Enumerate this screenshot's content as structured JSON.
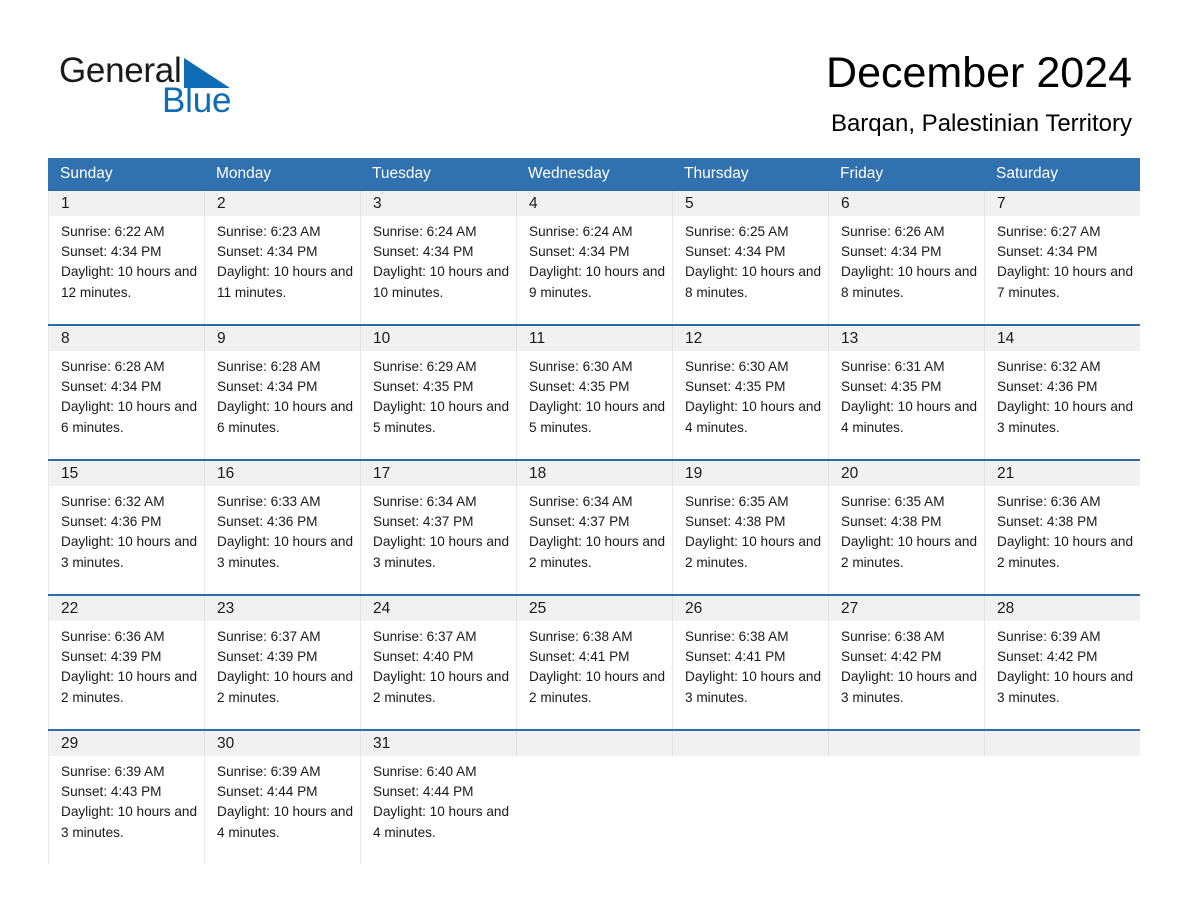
{
  "brand": {
    "name_part1": "General",
    "name_part2": "Blue",
    "triangle_color": "#0d6cb5",
    "text_color": "#1a1a1a"
  },
  "header": {
    "month_title": "December 2024",
    "location": "Barqan, Palestinian Territory"
  },
  "theme": {
    "header_blue": "#3071b0",
    "separator_blue": "#2e6da4",
    "date_band_gray": "#f1f1f1",
    "cell_border": "#e8e8e8"
  },
  "weekdays": [
    "Sunday",
    "Monday",
    "Tuesday",
    "Wednesday",
    "Thursday",
    "Friday",
    "Saturday"
  ],
  "weeks": [
    {
      "days": [
        {
          "date": "1",
          "sunrise": "Sunrise: 6:22 AM",
          "sunset": "Sunset: 4:34 PM",
          "daylight": "Daylight: 10 hours and 12 minutes."
        },
        {
          "date": "2",
          "sunrise": "Sunrise: 6:23 AM",
          "sunset": "Sunset: 4:34 PM",
          "daylight": "Daylight: 10 hours and 11 minutes."
        },
        {
          "date": "3",
          "sunrise": "Sunrise: 6:24 AM",
          "sunset": "Sunset: 4:34 PM",
          "daylight": "Daylight: 10 hours and 10 minutes."
        },
        {
          "date": "4",
          "sunrise": "Sunrise: 6:24 AM",
          "sunset": "Sunset: 4:34 PM",
          "daylight": "Daylight: 10 hours and 9 minutes."
        },
        {
          "date": "5",
          "sunrise": "Sunrise: 6:25 AM",
          "sunset": "Sunset: 4:34 PM",
          "daylight": "Daylight: 10 hours and 8 minutes."
        },
        {
          "date": "6",
          "sunrise": "Sunrise: 6:26 AM",
          "sunset": "Sunset: 4:34 PM",
          "daylight": "Daylight: 10 hours and 8 minutes."
        },
        {
          "date": "7",
          "sunrise": "Sunrise: 6:27 AM",
          "sunset": "Sunset: 4:34 PM",
          "daylight": "Daylight: 10 hours and 7 minutes."
        }
      ]
    },
    {
      "days": [
        {
          "date": "8",
          "sunrise": "Sunrise: 6:28 AM",
          "sunset": "Sunset: 4:34 PM",
          "daylight": "Daylight: 10 hours and 6 minutes."
        },
        {
          "date": "9",
          "sunrise": "Sunrise: 6:28 AM",
          "sunset": "Sunset: 4:34 PM",
          "daylight": "Daylight: 10 hours and 6 minutes."
        },
        {
          "date": "10",
          "sunrise": "Sunrise: 6:29 AM",
          "sunset": "Sunset: 4:35 PM",
          "daylight": "Daylight: 10 hours and 5 minutes."
        },
        {
          "date": "11",
          "sunrise": "Sunrise: 6:30 AM",
          "sunset": "Sunset: 4:35 PM",
          "daylight": "Daylight: 10 hours and 5 minutes."
        },
        {
          "date": "12",
          "sunrise": "Sunrise: 6:30 AM",
          "sunset": "Sunset: 4:35 PM",
          "daylight": "Daylight: 10 hours and 4 minutes."
        },
        {
          "date": "13",
          "sunrise": "Sunrise: 6:31 AM",
          "sunset": "Sunset: 4:35 PM",
          "daylight": "Daylight: 10 hours and 4 minutes."
        },
        {
          "date": "14",
          "sunrise": "Sunrise: 6:32 AM",
          "sunset": "Sunset: 4:36 PM",
          "daylight": "Daylight: 10 hours and 3 minutes."
        }
      ]
    },
    {
      "days": [
        {
          "date": "15",
          "sunrise": "Sunrise: 6:32 AM",
          "sunset": "Sunset: 4:36 PM",
          "daylight": "Daylight: 10 hours and 3 minutes."
        },
        {
          "date": "16",
          "sunrise": "Sunrise: 6:33 AM",
          "sunset": "Sunset: 4:36 PM",
          "daylight": "Daylight: 10 hours and 3 minutes."
        },
        {
          "date": "17",
          "sunrise": "Sunrise: 6:34 AM",
          "sunset": "Sunset: 4:37 PM",
          "daylight": "Daylight: 10 hours and 3 minutes."
        },
        {
          "date": "18",
          "sunrise": "Sunrise: 6:34 AM",
          "sunset": "Sunset: 4:37 PM",
          "daylight": "Daylight: 10 hours and 2 minutes."
        },
        {
          "date": "19",
          "sunrise": "Sunrise: 6:35 AM",
          "sunset": "Sunset: 4:38 PM",
          "daylight": "Daylight: 10 hours and 2 minutes."
        },
        {
          "date": "20",
          "sunrise": "Sunrise: 6:35 AM",
          "sunset": "Sunset: 4:38 PM",
          "daylight": "Daylight: 10 hours and 2 minutes."
        },
        {
          "date": "21",
          "sunrise": "Sunrise: 6:36 AM",
          "sunset": "Sunset: 4:38 PM",
          "daylight": "Daylight: 10 hours and 2 minutes."
        }
      ]
    },
    {
      "days": [
        {
          "date": "22",
          "sunrise": "Sunrise: 6:36 AM",
          "sunset": "Sunset: 4:39 PM",
          "daylight": "Daylight: 10 hours and 2 minutes."
        },
        {
          "date": "23",
          "sunrise": "Sunrise: 6:37 AM",
          "sunset": "Sunset: 4:39 PM",
          "daylight": "Daylight: 10 hours and 2 minutes."
        },
        {
          "date": "24",
          "sunrise": "Sunrise: 6:37 AM",
          "sunset": "Sunset: 4:40 PM",
          "daylight": "Daylight: 10 hours and 2 minutes."
        },
        {
          "date": "25",
          "sunrise": "Sunrise: 6:38 AM",
          "sunset": "Sunset: 4:41 PM",
          "daylight": "Daylight: 10 hours and 2 minutes."
        },
        {
          "date": "26",
          "sunrise": "Sunrise: 6:38 AM",
          "sunset": "Sunset: 4:41 PM",
          "daylight": "Daylight: 10 hours and 3 minutes."
        },
        {
          "date": "27",
          "sunrise": "Sunrise: 6:38 AM",
          "sunset": "Sunset: 4:42 PM",
          "daylight": "Daylight: 10 hours and 3 minutes."
        },
        {
          "date": "28",
          "sunrise": "Sunrise: 6:39 AM",
          "sunset": "Sunset: 4:42 PM",
          "daylight": "Daylight: 10 hours and 3 minutes."
        }
      ]
    },
    {
      "days": [
        {
          "date": "29",
          "sunrise": "Sunrise: 6:39 AM",
          "sunset": "Sunset: 4:43 PM",
          "daylight": "Daylight: 10 hours and 3 minutes."
        },
        {
          "date": "30",
          "sunrise": "Sunrise: 6:39 AM",
          "sunset": "Sunset: 4:44 PM",
          "daylight": "Daylight: 10 hours and 4 minutes."
        },
        {
          "date": "31",
          "sunrise": "Sunrise: 6:40 AM",
          "sunset": "Sunset: 4:44 PM",
          "daylight": "Daylight: 10 hours and 4 minutes."
        },
        {
          "date": "",
          "sunrise": "",
          "sunset": "",
          "daylight": ""
        },
        {
          "date": "",
          "sunrise": "",
          "sunset": "",
          "daylight": ""
        },
        {
          "date": "",
          "sunrise": "",
          "sunset": "",
          "daylight": ""
        },
        {
          "date": "",
          "sunrise": "",
          "sunset": "",
          "daylight": ""
        }
      ]
    }
  ]
}
